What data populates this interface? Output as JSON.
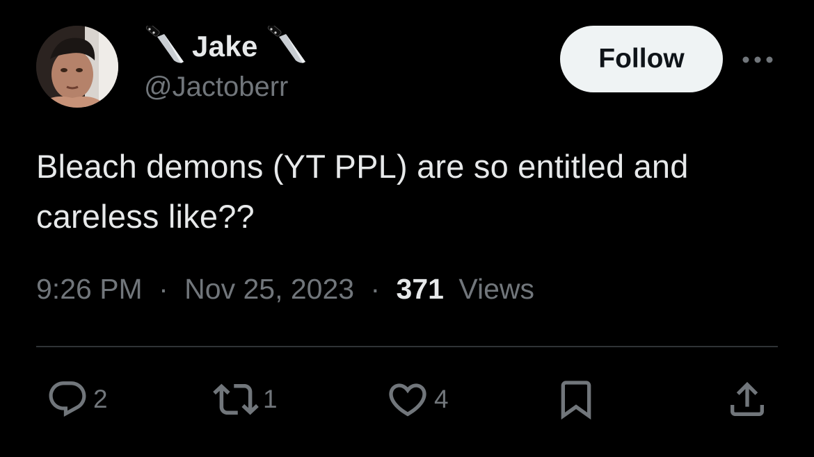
{
  "author": {
    "display_name": "Jake",
    "handle": "@Jactoberr",
    "name_emoji": "knife-icon"
  },
  "follow_button": {
    "label": "Follow"
  },
  "more_menu": {
    "icon": "more-icon"
  },
  "tweet": {
    "text_line1": "Bleach demons (YT PPL) are so entitled and",
    "text_line2": "careless like??",
    "time": "9:26 PM",
    "date": "Nov 25, 2023",
    "separator": "·",
    "views_count": "371",
    "views_label": "Views"
  },
  "actions": {
    "reply_count": "2",
    "repost_count": "1",
    "like_count": "4"
  },
  "colors": {
    "background": "#000000",
    "text_primary": "#e7e9ea",
    "text_secondary": "#71767b",
    "follow_bg": "#eff3f4",
    "divider": "#2f3336"
  }
}
